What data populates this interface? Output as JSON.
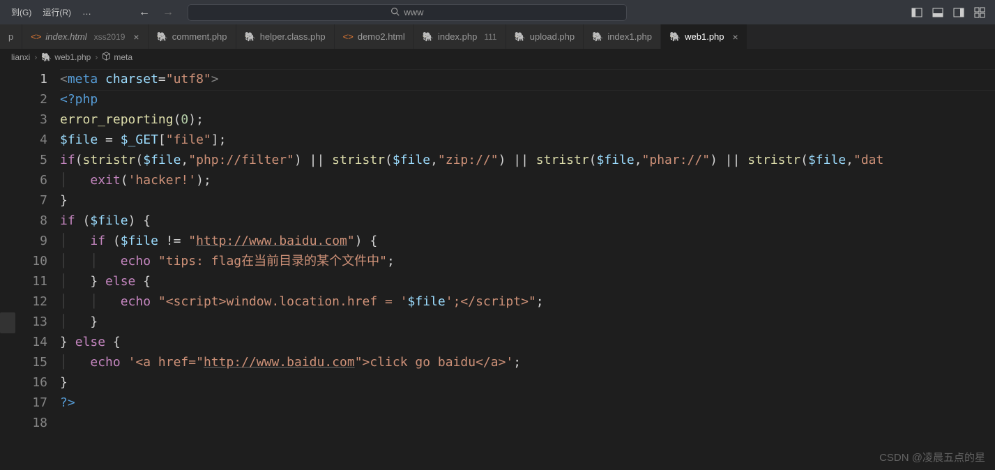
{
  "menu": {
    "item1": "到(G)",
    "item2": "运行(R)",
    "ellipsis": "…"
  },
  "search": {
    "text": "www"
  },
  "tabs": [
    {
      "icon": "p",
      "label": "p",
      "desc": "",
      "active": false,
      "type": "plain"
    },
    {
      "icon": "html",
      "label": "index.html",
      "desc": "xss2019",
      "active": false,
      "close": true,
      "type": "html"
    },
    {
      "icon": "php",
      "label": "comment.php",
      "desc": "",
      "active": false,
      "type": "php"
    },
    {
      "icon": "php",
      "label": "helper.class.php",
      "desc": "",
      "active": false,
      "type": "php"
    },
    {
      "icon": "html",
      "label": "demo2.html",
      "desc": "",
      "active": false,
      "type": "html"
    },
    {
      "icon": "php",
      "label": "index.php",
      "desc": "111",
      "active": false,
      "type": "php"
    },
    {
      "icon": "php",
      "label": "upload.php",
      "desc": "",
      "active": false,
      "type": "php"
    },
    {
      "icon": "php",
      "label": "index1.php",
      "desc": "",
      "active": false,
      "type": "php"
    },
    {
      "icon": "php",
      "label": "web1.php",
      "desc": "",
      "active": true,
      "close": true,
      "type": "php"
    }
  ],
  "breadcrumb": {
    "p0": "lianxi",
    "p1": "web1.php",
    "p2": "meta"
  },
  "code": {
    "line_count": 18,
    "active_line": 1,
    "lines_plain": [
      "<meta charset=\"utf8\">",
      "<?php",
      "error_reporting(0);",
      "$file = $_GET[\"file\"];",
      "if(stristr($file,\"php://filter\") || stristr($file,\"zip://\") || stristr($file,\"phar://\") || stristr($file,\"dat",
      "    exit('hacker!');",
      "}",
      "if ($file) {",
      "    if ($file != \"http://www.baidu.com\") {",
      "        echo \"tips: flag在当前目录的某个文件中\";",
      "    } else {",
      "        echo \"<__script>window.location.href = '$file';</__script>\";",
      "    }",
      "} else {",
      "    echo '<a href=\"http://www.baidu.com\">click go baidu</a>';",
      "}",
      "?>",
      ""
    ]
  },
  "watermark": "CSDN @凌晨五点的星"
}
